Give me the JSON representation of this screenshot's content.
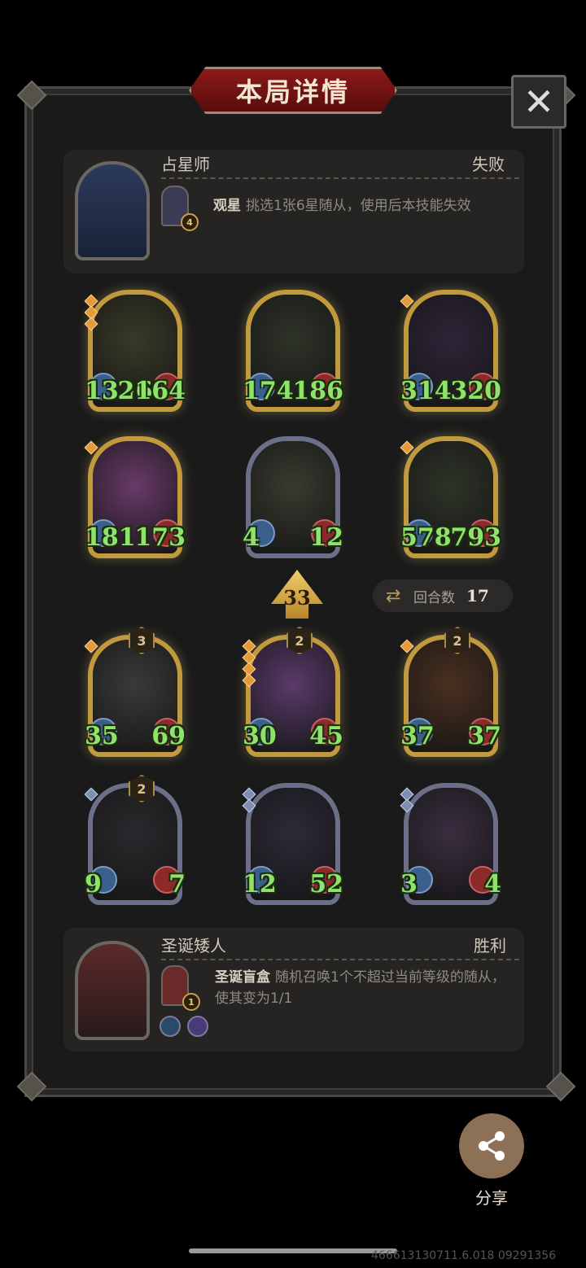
{
  "title": "本局详情",
  "close_icon": "close-icon",
  "opponent": {
    "name": "占星师",
    "result": "失败",
    "skill_name": "观星",
    "skill_desc": "挑选1张6星随从，使用后本技能失效",
    "skill_level": "4"
  },
  "opponent_board": [
    {
      "attack": "1336",
      "health": "2164",
      "frame": "gold",
      "stars": 3,
      "art": "#3a3a28"
    },
    {
      "attack": "174",
      "health": "186",
      "frame": "gold",
      "stars": 0,
      "art": "#2e3328"
    },
    {
      "attack": "314",
      "health": "320",
      "frame": "gold",
      "stars": 1,
      "art": "#2e2538"
    },
    {
      "attack": "181",
      "health": "173",
      "frame": "gold",
      "stars": 1,
      "art": "#6a3a6a"
    },
    {
      "attack": "4",
      "health": "12",
      "frame": "silver",
      "stars": 0,
      "art": "#3a3a30"
    },
    {
      "attack": "578",
      "health": "793",
      "frame": "gold",
      "stars": 1,
      "art": "#2e3428"
    }
  ],
  "damage_value": "33",
  "round": {
    "label": "回合数",
    "value": "17"
  },
  "player_board": [
    {
      "attack": "35",
      "health": "69",
      "frame": "gold",
      "level": "3",
      "stars": 1,
      "art": "#3a3a3a"
    },
    {
      "attack": "30",
      "health": "45",
      "frame": "gold",
      "level": "2",
      "stars": 4,
      "art": "#5a3a6a"
    },
    {
      "attack": "37",
      "health": "37",
      "frame": "gold",
      "level": "2",
      "stars": 1,
      "art": "#4a3020"
    },
    {
      "attack": "9",
      "health": "7",
      "frame": "silver",
      "level": "2",
      "stars": 1,
      "art": "#2a2a2e"
    },
    {
      "attack": "12",
      "health": "52",
      "frame": "silver",
      "level": "",
      "stars": 2,
      "art": "#2e2a38"
    },
    {
      "attack": "3",
      "health": "4",
      "frame": "silver",
      "level": "",
      "stars": 2,
      "art": "#3a2e40"
    }
  ],
  "player": {
    "name": "圣诞矮人",
    "result": "胜利",
    "skill_name": "圣诞盲盒",
    "skill_desc": "随机召唤1个不超过当前等级的随从，使其变为1/1",
    "skill_level": "1"
  },
  "share": {
    "label": "分享",
    "icon": "share-icon"
  },
  "watermark": "466613130711.6.018 09291356"
}
